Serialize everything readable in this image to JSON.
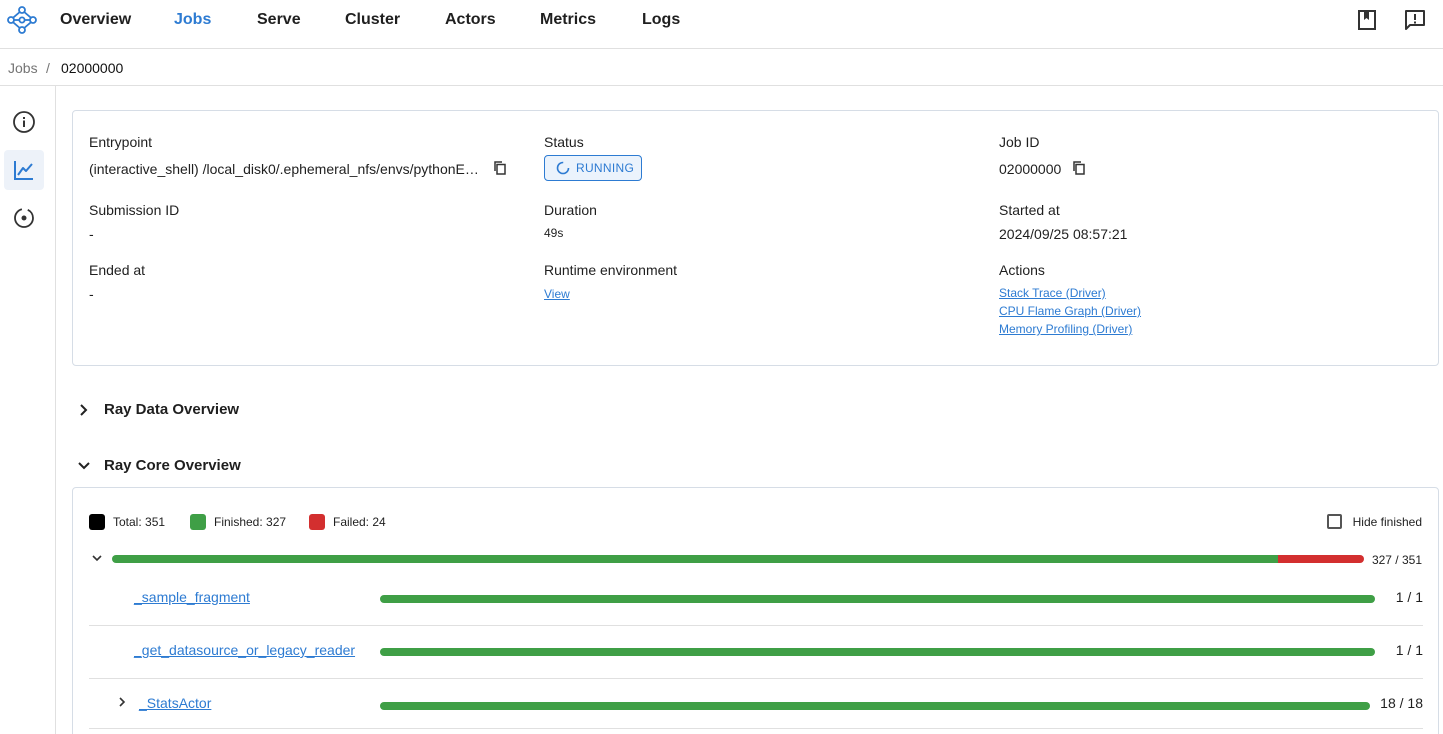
{
  "nav": {
    "items": [
      {
        "label": "Overview",
        "active": false
      },
      {
        "label": "Jobs",
        "active": true
      },
      {
        "label": "Serve",
        "active": false
      },
      {
        "label": "Cluster",
        "active": false
      },
      {
        "label": "Actors",
        "active": false
      },
      {
        "label": "Metrics",
        "active": false
      },
      {
        "label": "Logs",
        "active": false
      }
    ]
  },
  "breadcrumb": {
    "parent": "Jobs",
    "separator": "/",
    "current": "02000000"
  },
  "info": {
    "entrypoint_label": "Entrypoint",
    "entrypoint_value": "(interactive_shell) /local_disk0/.ephemeral_nfs/envs/pythonE…",
    "status_label": "Status",
    "status_value": "RUNNING",
    "jobid_label": "Job ID",
    "jobid_value": "02000000",
    "submission_label": "Submission ID",
    "submission_value": "-",
    "duration_label": "Duration",
    "duration_value": "49s",
    "started_label": "Started at",
    "started_value": "2024/09/25 08:57:21",
    "ended_label": "Ended at",
    "ended_value": "-",
    "runtime_label": "Runtime environment",
    "runtime_link": "View",
    "actions_label": "Actions",
    "actions": [
      "Stack Trace (Driver)",
      "CPU Flame Graph (Driver)",
      "Memory Profiling (Driver)"
    ]
  },
  "sections": {
    "ray_data": "Ray Data Overview",
    "ray_core": "Ray Core Overview"
  },
  "core": {
    "legend": [
      {
        "label": "Total: 351",
        "color": "#000000"
      },
      {
        "label": "Finished: 327",
        "color": "#3f9f46"
      },
      {
        "label": "Failed: 24",
        "color": "#d32f2f"
      }
    ],
    "hide_finished": "Hide finished",
    "total": 351,
    "finished": 327,
    "failed": 24,
    "total_count": "327 / 351",
    "rows": [
      {
        "name": "_sample_fragment",
        "count": "1 / 1",
        "progress": 1.0
      },
      {
        "name": "_get_datasource_or_legacy_reader",
        "count": "1 / 1",
        "progress": 1.0
      },
      {
        "name": "_StatsActor",
        "count": "18 / 18",
        "progress": 1.0
      }
    ]
  },
  "colors": {
    "accent": "#2d7bd2",
    "finished": "#3f9f46",
    "failed": "#d32f2f"
  }
}
